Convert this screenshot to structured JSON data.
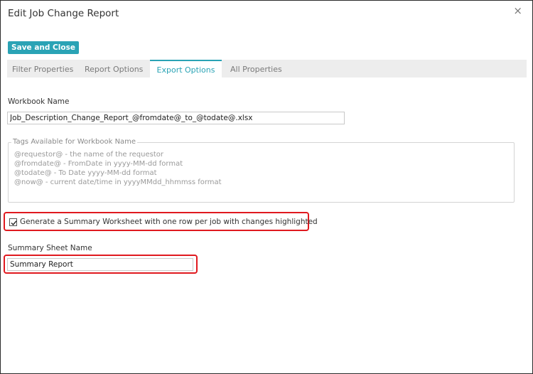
{
  "dialog": {
    "title": "Edit Job Change Report",
    "close_glyph": "×"
  },
  "toolbar": {
    "save_label": "Save and Close",
    "accent_color": "#2aa3b5"
  },
  "tabs": [
    {
      "label": "Filter Properties",
      "active": false
    },
    {
      "label": "Report Options",
      "active": false
    },
    {
      "label": "Export Options",
      "active": true
    },
    {
      "label": "All Properties",
      "active": false
    }
  ],
  "workbook": {
    "label": "Workbook Name",
    "value": "Job_Description_Change_Report_@fromdate@_to_@todate@.xlsx"
  },
  "tags": {
    "legend": "Tags Available for Workbook Name",
    "lines": [
      "@requestor@ - the name of the requestor",
      "@fromdate@ - FromDate  in yyyy-MM-dd format",
      "@todate@ - To Date yyyy-MM-dd format",
      "@now@ - current date/time in yyyyMMdd_hhmmss format"
    ]
  },
  "summary": {
    "checkbox_label": "Generate a Summary Worksheet with one row per job with changes highlighted",
    "checked": true,
    "sheet_label": "Summary Sheet Name",
    "sheet_value": "Summary Report",
    "highlight_color": "#e0191f"
  },
  "icons": {
    "close": "close-icon",
    "check": "checkmark-icon"
  }
}
